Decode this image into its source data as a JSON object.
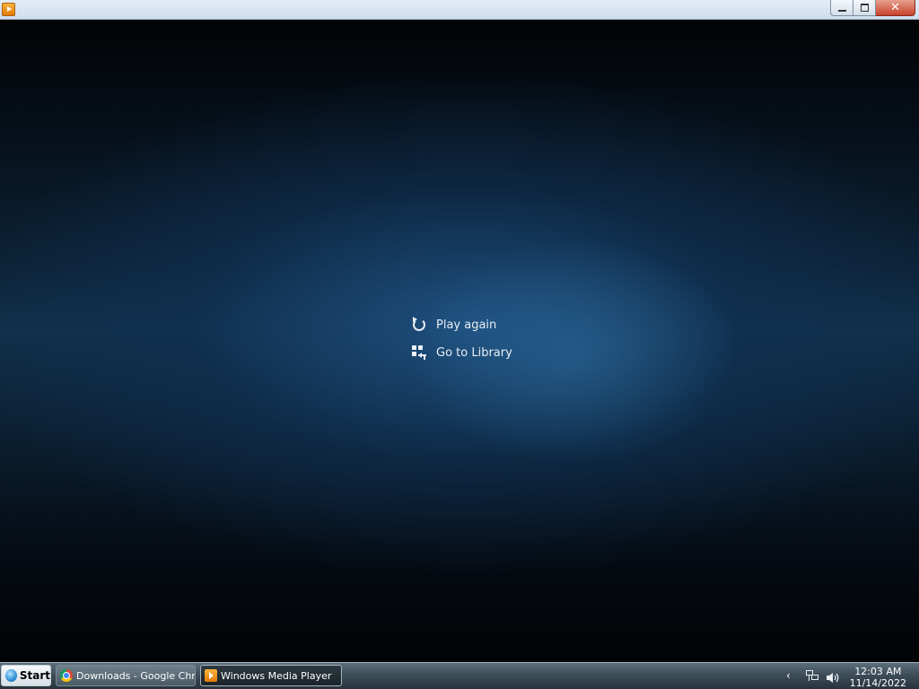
{
  "window": {
    "app_icon": "windows-media-player-icon",
    "controls": {
      "minimize": "minimize-icon",
      "restore": "restore-icon",
      "close": "close-icon"
    }
  },
  "player": {
    "actions": [
      {
        "label": "Play again",
        "icon": "replay-icon"
      },
      {
        "label": "Go to Library",
        "icon": "library-icon"
      }
    ],
    "background_accent": "#1e5080"
  },
  "taskbar": {
    "start_label": "Start",
    "tasks": [
      {
        "label": "Downloads - Google Chr...",
        "icon": "chrome-icon",
        "active": false
      },
      {
        "label": "Windows Media Player",
        "icon": "windows-media-player-icon",
        "active": true
      }
    ],
    "tray": {
      "icons": [
        "show-hidden-icons-chevron",
        "network-icon",
        "volume-icon"
      ],
      "time": "12:03 AM",
      "date": "11/14/2022"
    }
  }
}
